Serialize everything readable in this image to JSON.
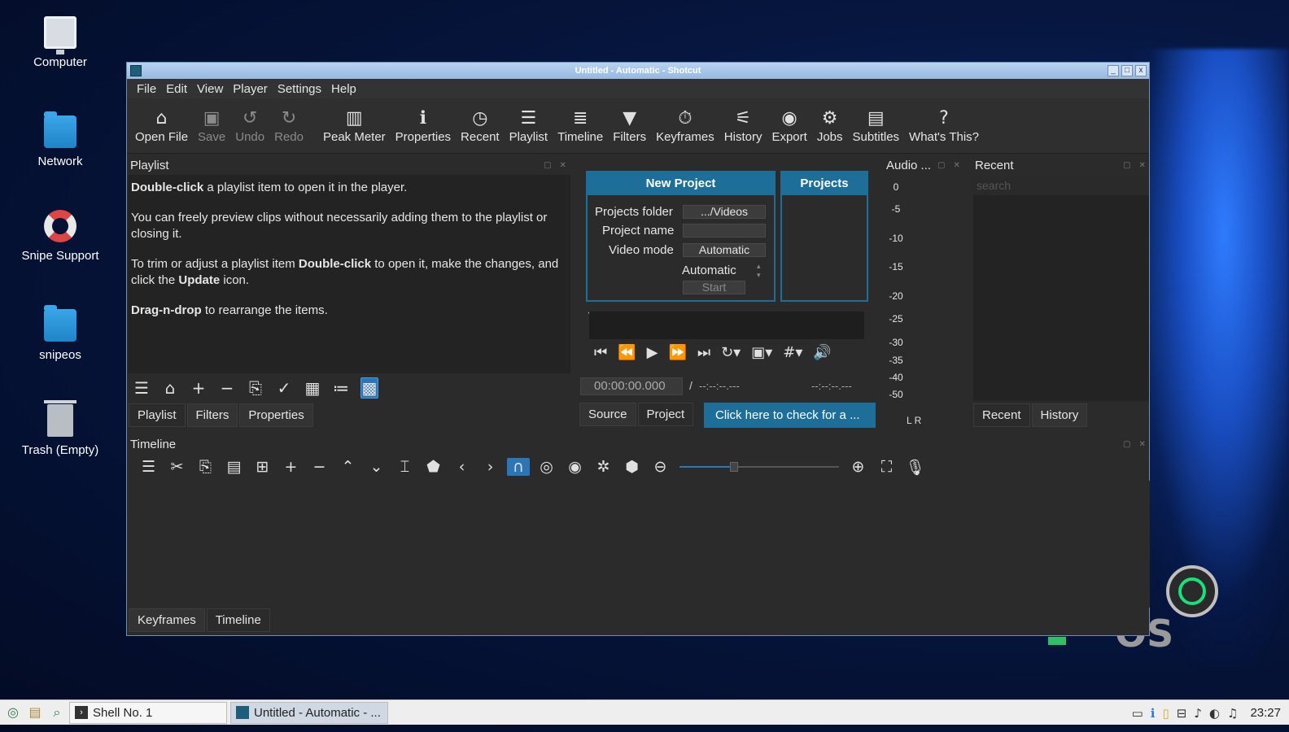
{
  "desktop": {
    "icons": [
      {
        "label": "Computer",
        "icon": "computer-icon"
      },
      {
        "label": "Network",
        "icon": "network-folder-icon"
      },
      {
        "label": "Snipe Support",
        "icon": "lifebuoy-icon"
      },
      {
        "label": "snipeos",
        "icon": "home-folder-icon"
      },
      {
        "label": "Trash (Empty)",
        "icon": "trash-icon"
      }
    ],
    "logo_text": "OS"
  },
  "window": {
    "title": "Untitled - Automatic - Shotcut",
    "controls": [
      "_",
      "□",
      "x"
    ]
  },
  "menu": [
    "File",
    "Edit",
    "View",
    "Player",
    "Settings",
    "Help"
  ],
  "toolbar": [
    {
      "label": "Open File",
      "icon": "open-folder-icon",
      "enabled": true
    },
    {
      "label": "Save",
      "icon": "save-icon",
      "enabled": false
    },
    {
      "label": "Undo",
      "icon": "undo-icon",
      "enabled": false
    },
    {
      "label": "Redo",
      "icon": "redo-icon",
      "enabled": false
    },
    {
      "label": "Peak Meter",
      "icon": "peak-meter-icon",
      "enabled": true
    },
    {
      "label": "Properties",
      "icon": "info-icon",
      "enabled": true
    },
    {
      "label": "Recent",
      "icon": "clock-icon",
      "enabled": true
    },
    {
      "label": "Playlist",
      "icon": "list-icon",
      "enabled": true
    },
    {
      "label": "Timeline",
      "icon": "timeline-icon",
      "enabled": true
    },
    {
      "label": "Filters",
      "icon": "filter-icon",
      "enabled": true
    },
    {
      "label": "Keyframes",
      "icon": "stopwatch-icon",
      "enabled": true
    },
    {
      "label": "History",
      "icon": "history-icon",
      "enabled": true
    },
    {
      "label": "Export",
      "icon": "export-icon",
      "enabled": true
    },
    {
      "label": "Jobs",
      "icon": "gear-icon",
      "enabled": true
    },
    {
      "label": "Subtitles",
      "icon": "subtitles-icon",
      "enabled": true
    },
    {
      "label": "What's This?",
      "icon": "question-icon",
      "enabled": true
    }
  ],
  "playlist": {
    "title": "Playlist",
    "help": {
      "p1_bold": "Double-click",
      "p1_rest": " a playlist item to open it in the player.",
      "p2": "You can freely preview clips without necessarily adding them to the playlist or closing it.",
      "p3_a": "To trim or adjust a playlist item ",
      "p3_b": "Double-click",
      "p3_c": " to open it, make the changes, and click the ",
      "p3_d": "Update",
      "p3_e": " icon.",
      "p4_bold": "Drag-n-drop",
      "p4_rest": " to rearrange the items."
    },
    "tabs": [
      "Playlist",
      "Filters",
      "Properties"
    ]
  },
  "new_project": {
    "header": "New Project",
    "projects_folder_label": "Projects folder",
    "projects_folder_value": ".../Videos",
    "project_name_label": "Project name",
    "project_name_value": "",
    "video_mode_label": "Video mode",
    "video_mode_value": "Automatic",
    "automatic_label": "Automatic",
    "start_label": "Start"
  },
  "projects": {
    "header": "Projects"
  },
  "player": {
    "timecode": "00:00:00.000",
    "separator": "/",
    "duration": "--:--:--.---",
    "in_out": "--:--:--.---",
    "tabs": [
      "Source",
      "Project"
    ],
    "update_banner": "Click here to check for a ..."
  },
  "audio": {
    "title": "Audio ...",
    "scale": [
      "0",
      "-5",
      "-10",
      "-15",
      "-20",
      "-25",
      "-30",
      "-35",
      "-40",
      "-50"
    ],
    "channels": "L  R"
  },
  "recent": {
    "title": "Recent",
    "search_placeholder": "search",
    "tabs": [
      "Recent",
      "History"
    ]
  },
  "timeline": {
    "title": "Timeline",
    "tabs": [
      "Keyframes",
      "Timeline"
    ]
  },
  "taskbar": {
    "tasks": [
      {
        "label": "Shell No. 1",
        "active": false
      },
      {
        "label": "Untitled - Automatic - ...",
        "active": true
      }
    ],
    "clock": "23:27"
  },
  "colors": {
    "accent": "#1d6e99",
    "active_tool": "#2b76b7",
    "window_bg": "#2b2b2b"
  }
}
